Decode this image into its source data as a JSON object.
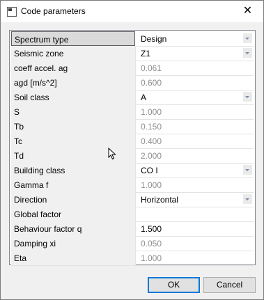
{
  "window": {
    "title": "Code parameters",
    "close_glyph": "✕"
  },
  "parameters": [
    {
      "name": "Spectrum type",
      "value": "Design",
      "editable": true,
      "dropdown": true
    },
    {
      "name": "Seismic zone",
      "value": "Z1",
      "editable": true,
      "dropdown": true
    },
    {
      "name": "coeff accel. ag",
      "value": "0.061",
      "editable": false,
      "dropdown": false
    },
    {
      "name": "agd [m/s^2]",
      "value": "0.600",
      "editable": false,
      "dropdown": false
    },
    {
      "name": "Soil class",
      "value": "A",
      "editable": true,
      "dropdown": true
    },
    {
      "name": "S",
      "value": "1.000",
      "editable": false,
      "dropdown": false
    },
    {
      "name": "Tb",
      "value": "0.150",
      "editable": false,
      "dropdown": false
    },
    {
      "name": "Tc",
      "value": "0.400",
      "editable": false,
      "dropdown": false
    },
    {
      "name": "Td",
      "value": "2.000",
      "editable": false,
      "dropdown": false
    },
    {
      "name": "Building class",
      "value": "CO I",
      "editable": true,
      "dropdown": true
    },
    {
      "name": "Gamma f",
      "value": "1.000",
      "editable": false,
      "dropdown": false
    },
    {
      "name": "Direction",
      "value": "Horizontal",
      "editable": true,
      "dropdown": true
    },
    {
      "name": "Global factor",
      "value": "",
      "editable": false,
      "dropdown": false
    },
    {
      "name": "Behaviour factor q",
      "value": "1.500",
      "editable": true,
      "dropdown": false
    },
    {
      "name": "Damping xi",
      "value": "0.050",
      "editable": false,
      "dropdown": false
    },
    {
      "name": "Eta",
      "value": "1.000",
      "editable": false,
      "dropdown": false
    }
  ],
  "buttons": {
    "ok": "OK",
    "cancel": "Cancel"
  }
}
